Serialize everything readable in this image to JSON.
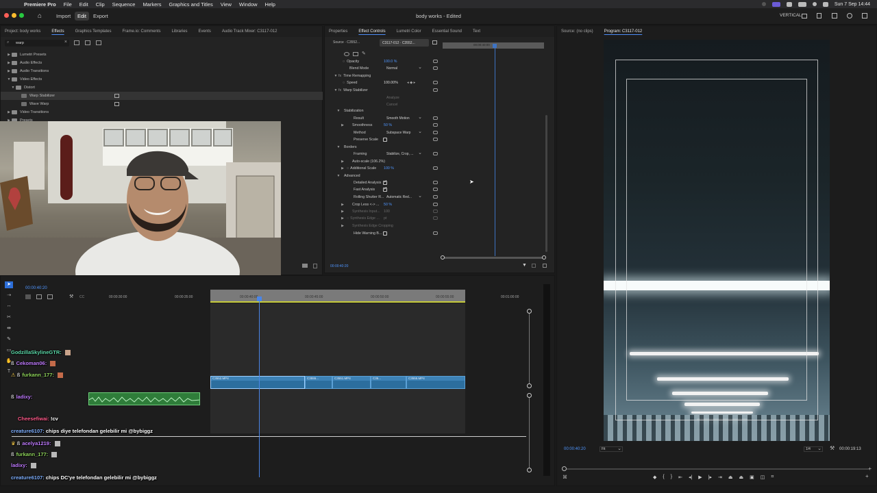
{
  "menubar": {
    "app": "Premiere Pro",
    "items": [
      "File",
      "Edit",
      "Clip",
      "Sequence",
      "Markers",
      "Graphics and Titles",
      "View",
      "Window",
      "Help"
    ],
    "clock": "Sun 7 Sep  14:44"
  },
  "header": {
    "workspaces": [
      "Import",
      "Edit",
      "Export"
    ],
    "active_workspace": "Edit",
    "title": "body works - Edited",
    "layout_label": "VERTICAL"
  },
  "effects_panel": {
    "tabs": [
      "Project: body works",
      "Effects",
      "Graphics Templates",
      "Frame.io: Comments",
      "Libraries",
      "Events",
      "Audio Track Mixer: C3117-012"
    ],
    "active_tab": "Effects",
    "search_value": "warp",
    "tree": [
      {
        "label": "Lumetri Presets",
        "level": 0
      },
      {
        "label": "Audio Effects",
        "level": 0
      },
      {
        "label": "Audio Transitions",
        "level": 0
      },
      {
        "label": "Video Effects",
        "level": 0
      },
      {
        "label": "Distort",
        "level": 1
      },
      {
        "label": "Warp Stabilizer",
        "level": 2
      },
      {
        "label": "Wave Warp",
        "level": 2
      },
      {
        "label": "Video Transitions",
        "level": 0
      },
      {
        "label": "Presets",
        "level": 0
      }
    ]
  },
  "effect_controls": {
    "tabs": [
      "Properties",
      "Effect Controls",
      "Lumetri Color",
      "Essential Sound",
      "Text"
    ],
    "active_tab": "Effect Controls",
    "source_label": "Source · C3552...",
    "clip_label": "C3117-012 · C3552...",
    "time_label": "00:00:40:00",
    "current_time": "00:00:40:20",
    "rows": {
      "opacity": "Opacity",
      "opacity_val": "100.0 %",
      "blend_mode": "Blend Mode",
      "blend_mode_val": "Normal",
      "time_remapping": "Time Remapping",
      "speed": "Speed",
      "speed_val": "100.00%",
      "warp_stabilizer": "Warp Stabilizer",
      "analyze": "Analyze",
      "cancel": "Cancel",
      "stabilization": "Stabilization",
      "result": "Result",
      "result_val": "Smooth Motion",
      "smoothness": "Smoothness",
      "smoothness_val": "50 %",
      "method": "Method",
      "method_val": "Subspace Warp",
      "preserve_scale": "Preserve Scale",
      "borders": "Borders",
      "framing": "Framing",
      "framing_val": "Stabilize, Crop, ...",
      "auto_scale": "Auto-scale (106.2%)",
      "additional_scale": "Additional Scale",
      "additional_scale_val": "100 %",
      "advanced": "Advanced",
      "detailed_analysis": "Detailed Analysis",
      "fast_analysis": "Fast Analysis",
      "rolling_shutter": "Rolling Shutter R...",
      "rolling_shutter_val": "Automatic Red...",
      "crop_less": "Crop Less <-> ...",
      "crop_less_val": "50 %",
      "synthesis_input": "Synthesis Input...",
      "synthesis_input_val": "100",
      "synthesis_edge": "Synthesis Edge ...",
      "synthesis_edge_val": "pt",
      "synthesis_edge_cropping": "Synthesis Edge Cropping",
      "hide_warning": "Hide Warning B..."
    }
  },
  "program_monitor": {
    "tabs": [
      "Source: (no clips)",
      "Program: C3117-012"
    ],
    "active_tab": "Program: C3117-012",
    "timecode": "00:00:40:20",
    "fit": "Fit",
    "resolution": "1/4",
    "duration": "00:00:19:13"
  },
  "timeline": {
    "timecode": "00:00:40:20",
    "ruler": [
      "00:00:30:00",
      "00:00:35:00",
      "00:00:40:00",
      "00:00:45:00",
      "00:00:50:00",
      "00:00:55:00",
      "00:01:00:00"
    ],
    "clips": [
      "C3552.MP4",
      "C3555...",
      "C3551.MP4",
      "C35...",
      "C3555.MP4"
    ]
  },
  "chat": [
    {
      "user": "GodzillaSkylineGTR:",
      "msg": "",
      "color": "#5bd9a8"
    },
    {
      "user": "Cekoman06:",
      "msg": "",
      "color": "#c07bff"
    },
    {
      "user": "furkann_177:",
      "msg": "",
      "color": "#8ed45a"
    },
    {
      "user": "ladixy:",
      "msg": "",
      "color": "#c07bff"
    },
    {
      "user": "Cheesefiwai:",
      "msg": "!cv",
      "color": "#ff5a8a"
    },
    {
      "user": "creature6107:",
      "msg": "chips diye telefondan gelebilir mi @bybiggz",
      "color": "#7fb0ff"
    },
    {
      "user": "acelya1219:",
      "msg": "",
      "color": "#c07bff"
    },
    {
      "user": "furkann_177:",
      "msg": "",
      "color": "#8ed45a"
    },
    {
      "user": "ladixy:",
      "msg": "",
      "color": "#c07bff"
    },
    {
      "user": "creature6107:",
      "msg": "chips DC'ye telefondan gelebilir mi @bybiggz",
      "color": "#7fb0ff"
    }
  ],
  "colors": {
    "accent": "#4d8ef7",
    "clip_blue": "#2c6e9e",
    "audio_green": "#2f7d3a"
  }
}
